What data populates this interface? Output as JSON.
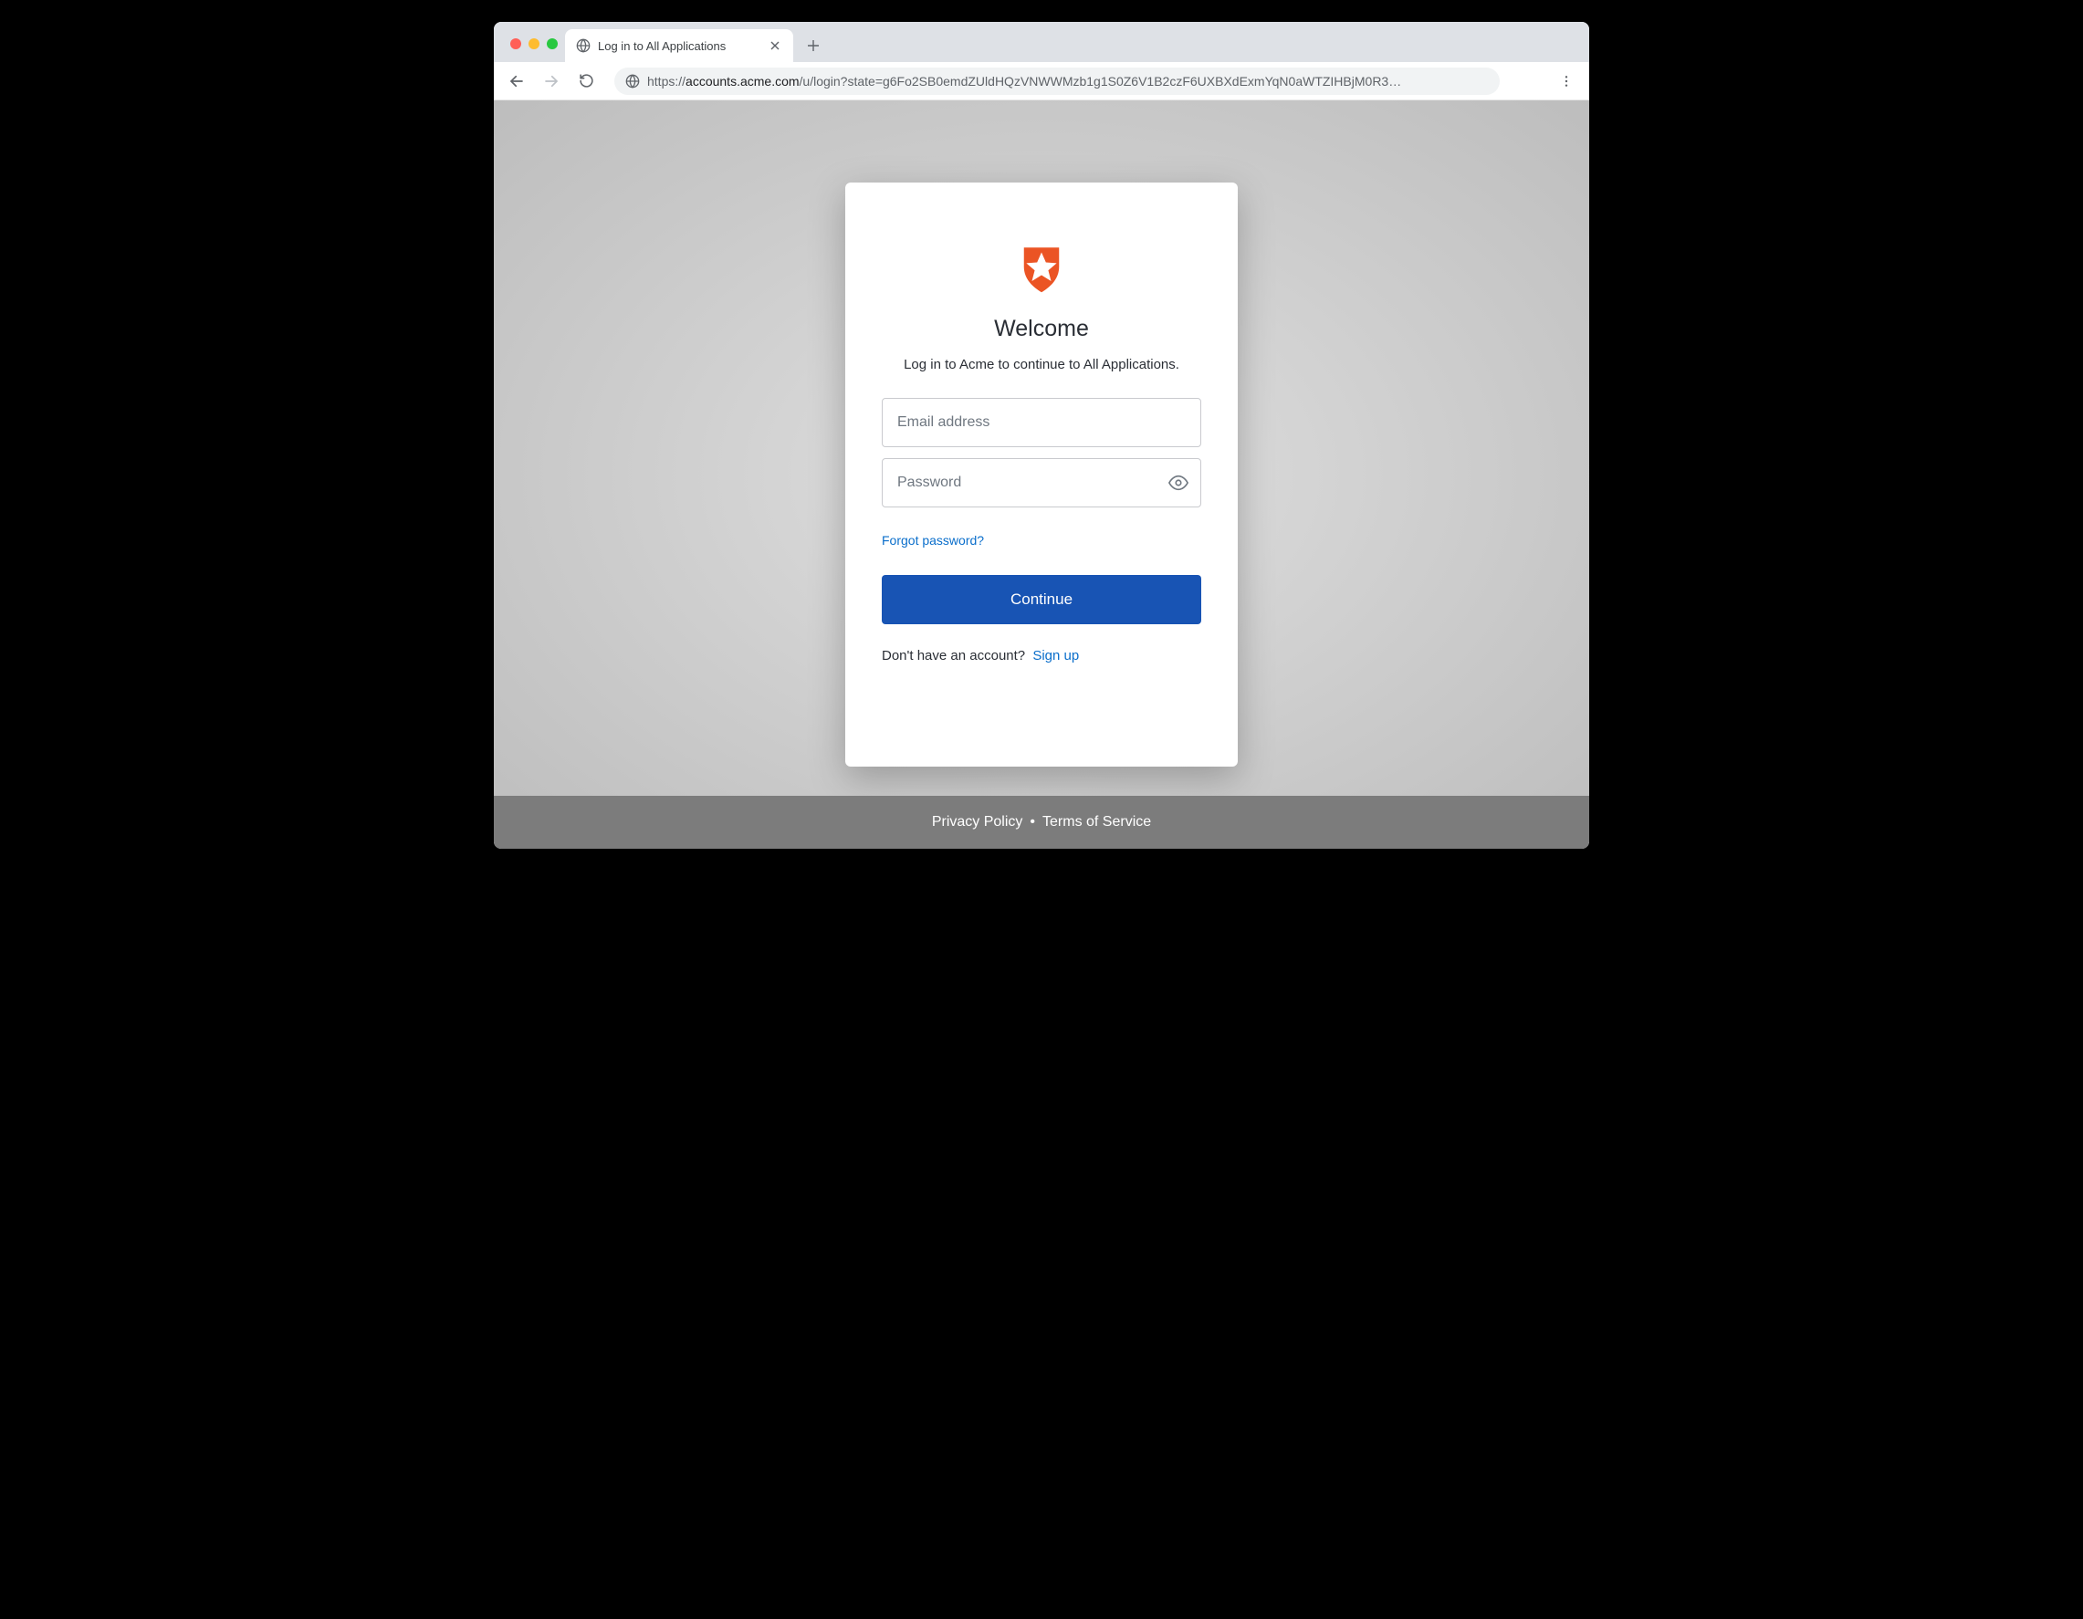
{
  "browser": {
    "tab_title": "Log in to All Applications",
    "url_protocol": "https://",
    "url_domain": "accounts.acme.com",
    "url_path": "/u/login?state=g6Fo2SB0emdZUldHQzVNWWMzb1g1S0Z6V1B2czF6UXBXdExmYqN0aWTZIHBjM0R3…"
  },
  "login": {
    "heading": "Welcome",
    "subtitle": "Log in to Acme to continue to All Applications.",
    "email_placeholder": "Email address",
    "password_placeholder": "Password",
    "forgot_password": "Forgot password?",
    "continue_button": "Continue",
    "signup_prompt": "Don't have an account?",
    "signup_link": "Sign up"
  },
  "footer": {
    "privacy": "Privacy Policy",
    "terms": "Terms of Service"
  }
}
